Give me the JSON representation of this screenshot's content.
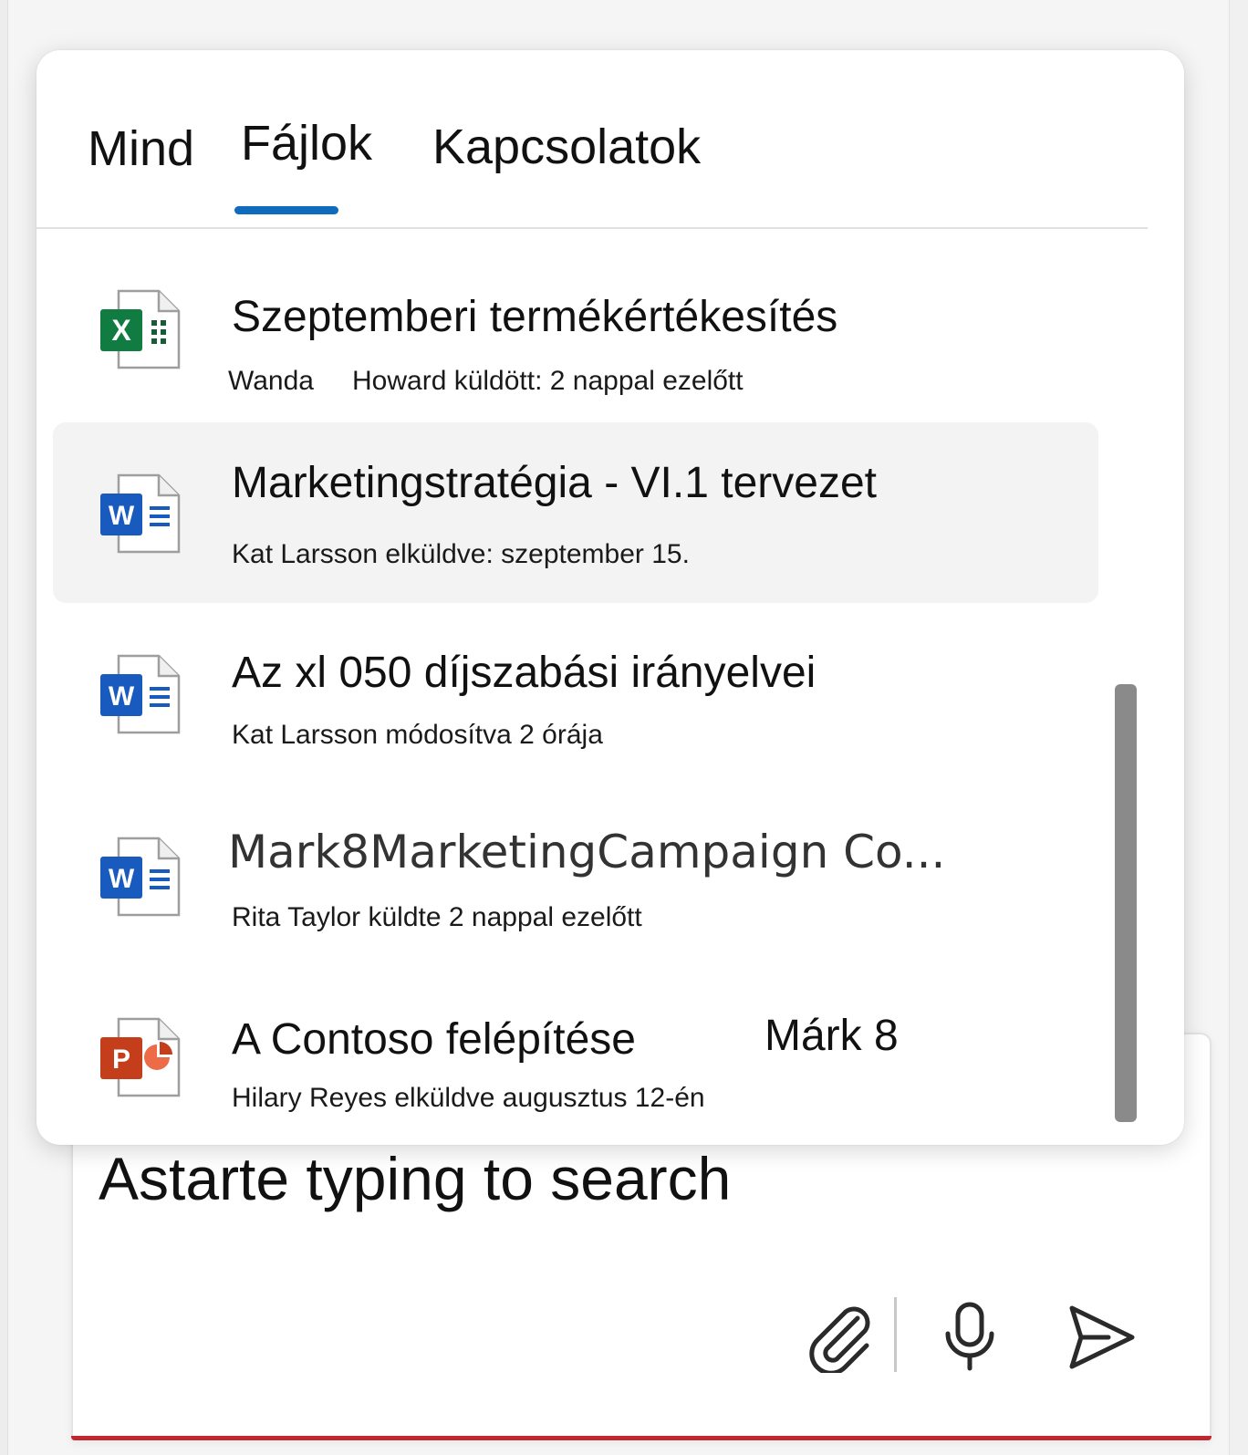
{
  "tabs": [
    {
      "label": "Mind"
    },
    {
      "label": "Fájlok",
      "selected": true
    },
    {
      "label": "Kapcsolatok"
    }
  ],
  "files": [
    {
      "type": "excel",
      "icon": "excel-file-icon",
      "title": "Szeptemberi termékértékesítés",
      "subtitle_prefix": "Wanda",
      "subtitle": "Howard küldött: 2 nappal ezelőtt"
    },
    {
      "type": "word",
      "icon": "word-file-icon",
      "title": "Marketingstratégia - VI.1 tervezet",
      "subtitle": "Kat Larsson elküldve: szeptember 15.",
      "selected": true
    },
    {
      "type": "word",
      "icon": "word-file-icon",
      "title": "Az xl 050 díjszabási irányelvei",
      "subtitle": "Kat Larsson módosítva 2 órája"
    },
    {
      "type": "word",
      "icon": "word-file-icon",
      "title": "Mark8MarketingCampaign Co...",
      "subtitle": "Rita Taylor küldte 2 nappal ezelőtt"
    },
    {
      "type": "powerpoint",
      "icon": "powerpoint-file-icon",
      "title": "A Contoso felépítése",
      "title_suffix": "Márk 8",
      "subtitle": "Hilary Reyes elküldve augusztus 12-én"
    }
  ],
  "search": {
    "placeholder": "Astarte typing to search"
  },
  "actions": {
    "attach_icon": "paperclip-icon",
    "mic_icon": "microphone-icon",
    "send_icon": "send-icon"
  },
  "colors": {
    "tab_indicator": "#0f6cbd",
    "excel": "#107c41",
    "word": "#185abd",
    "powerpoint": "#c43e1c",
    "compose_underline": "#c4262e"
  }
}
